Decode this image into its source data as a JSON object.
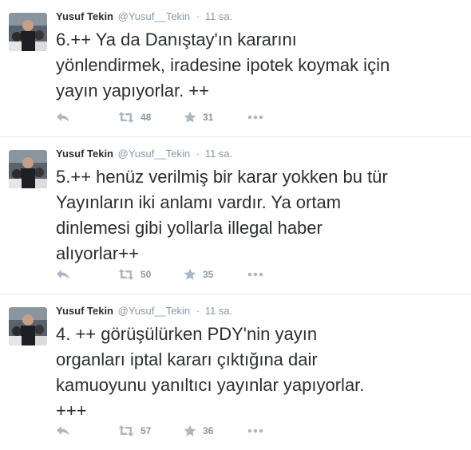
{
  "colors": {
    "text": "#292f33",
    "muted": "#8899a6",
    "icon": "#aab8c2",
    "divider": "#e1e8ed"
  },
  "tweets": [
    {
      "fullname": "Yusuf Tekin",
      "username": "@Yusuf__Tekin",
      "separator": "·",
      "time": "11 sa.",
      "text": "6.++ Ya da Danıştay'ın kararını\nyönlendirmek, iradesine ipotek koymak için\nyayın yapıyorlar. ++",
      "retweets": "48",
      "favorites": "31",
      "icons": [
        "reply-icon",
        "retweet-icon",
        "favorite-star-icon",
        "more-icon"
      ]
    },
    {
      "fullname": "Yusuf Tekin",
      "username": "@Yusuf__Tekin",
      "separator": "·",
      "time": "11 sa.",
      "text": "5.++ henüz verilmiş bir karar yokken bu tür\nYayınların iki anlamı vardır. Ya ortam\ndinlemesi gibi yollarla illegal haber\nalıyorlar++",
      "retweets": "50",
      "favorites": "35",
      "icons": [
        "reply-icon",
        "retweet-icon",
        "favorite-star-icon",
        "more-icon"
      ]
    },
    {
      "fullname": "Yusuf Tekin",
      "username": "@Yusuf__Tekin",
      "separator": "·",
      "time": "11 sa.",
      "text": "4. ++ görüşülürken PDY'nin yayın\norganları iptal kararı çıktığına dair\nkamuoyunu yanıltıcı yayınlar yapıyorlar.\n+++",
      "retweets": "57",
      "favorites": "36",
      "icons": [
        "reply-icon",
        "retweet-icon",
        "favorite-star-icon",
        "more-icon"
      ]
    }
  ]
}
